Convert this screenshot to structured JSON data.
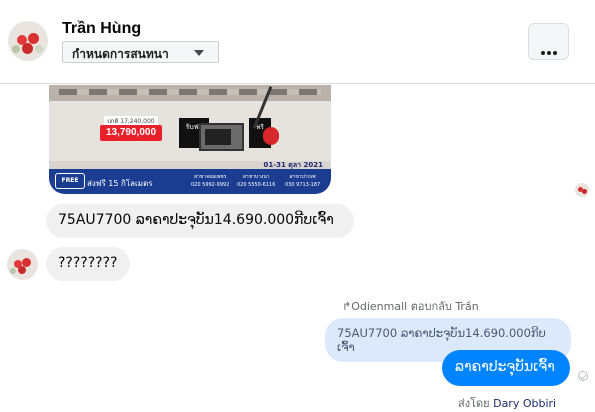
{
  "header": {
    "name": "Trần Hùng",
    "nickname_button": "กำหนดการสนทนา"
  },
  "promo_image": {
    "old_price": "ปกติ 17,240,000",
    "price": "13,790,000",
    "gift1": "รับฟรี",
    "gift2": "ฟรี",
    "date": "01-31 ตุลา 2021",
    "free_label": "FREE",
    "delivery": "ส่งฟรี 15 กิโลเมตร",
    "branches": [
      {
        "name": "สาขาจอมเพชร",
        "phone": "020 5992-9992"
      },
      {
        "name": "สาขาบางนา",
        "phone": "020 5550-6116"
      },
      {
        "name": "สาขาปากเซ",
        "phone": "030 9713-187"
      }
    ]
  },
  "messages": {
    "msg1": "75AU7700 ລາຄາປະຈຸບັນ14.690.000ກີບເຈົ້າ",
    "msg2": "????????",
    "reply_label": "Odienmall ตอบกลับ Trần",
    "quoted": "75AU7700 ລາຄາປະຈຸບັນ14.690.000ກີບເຈົ້າ",
    "sent": "ລາຄາປະຈຸບັນເຈົ້າ"
  },
  "footer": {
    "prefix": "ส่งโดย",
    "name": "Dary Obbiri"
  }
}
